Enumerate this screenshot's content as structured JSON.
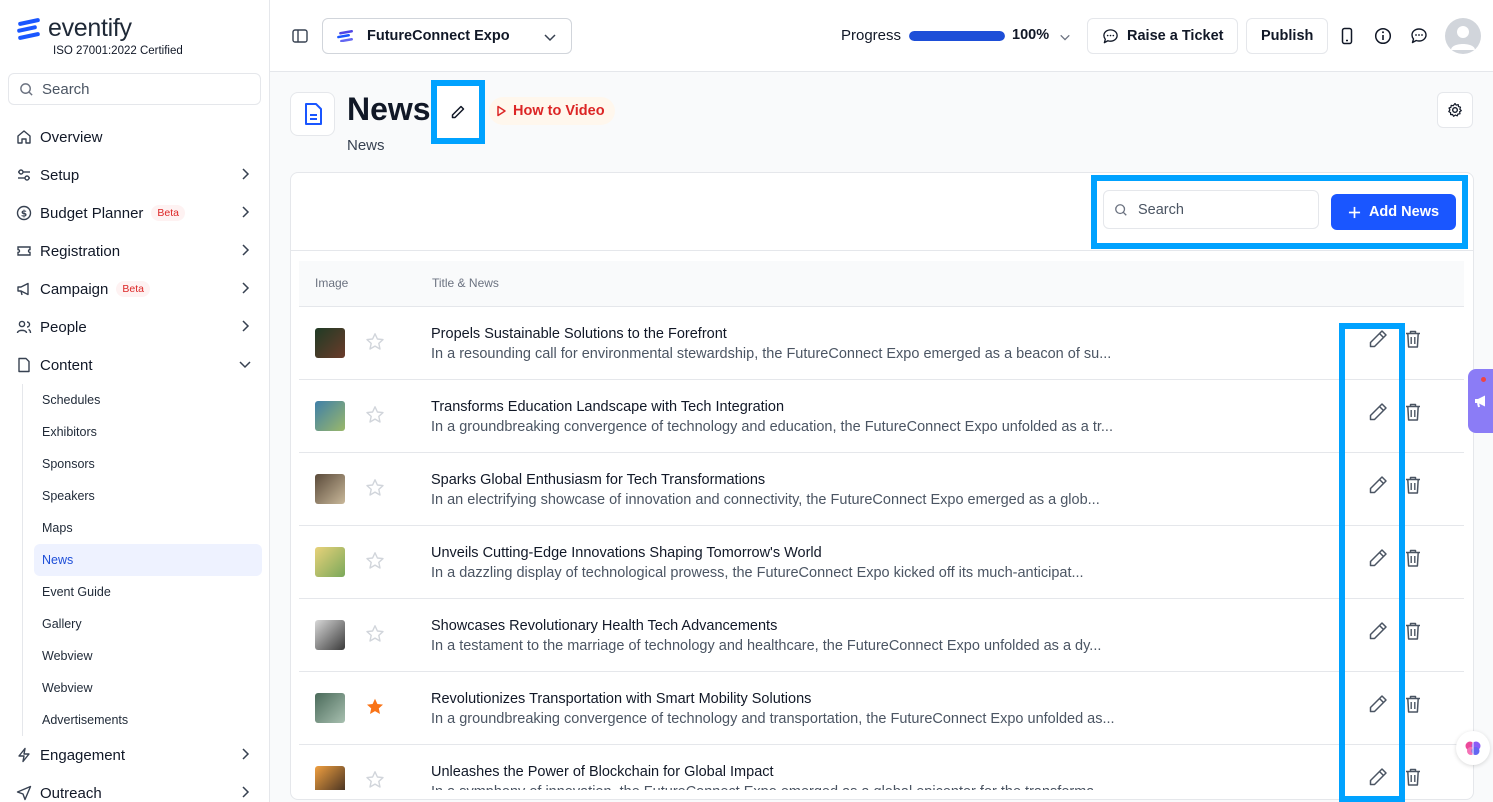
{
  "brand": {
    "name": "eventify",
    "certification": "ISO 27001:2022 Certified"
  },
  "sidebar": {
    "search_placeholder": "Search",
    "items": [
      {
        "label": "Overview",
        "icon": "home-icon"
      },
      {
        "label": "Setup",
        "icon": "sliders-icon"
      },
      {
        "label": "Budget Planner",
        "icon": "dollar-icon",
        "badge": "Beta"
      },
      {
        "label": "Registration",
        "icon": "ticket-icon"
      },
      {
        "label": "Campaign",
        "icon": "megaphone-icon",
        "badge": "Beta"
      },
      {
        "label": "People",
        "icon": "people-icon"
      },
      {
        "label": "Content",
        "icon": "document-icon"
      }
    ],
    "content_sub": [
      "Schedules",
      "Exhibitors",
      "Sponsors",
      "Speakers",
      "Maps",
      "News",
      "Event Guide",
      "Gallery",
      "Webview",
      "Webview",
      "Advertisements"
    ],
    "active_sub": "News",
    "bottom_items": [
      {
        "label": "Engagement",
        "icon": "bolt-icon"
      },
      {
        "label": "Outreach",
        "icon": "send-icon"
      }
    ]
  },
  "topbar": {
    "event_name": "FutureConnect Expo",
    "progress_label": "Progress",
    "progress_value": "100%",
    "progress_fraction": 1.0,
    "raise_ticket": "Raise a Ticket",
    "publish": "Publish"
  },
  "page": {
    "title": "News",
    "how_to": "How to Video",
    "subtitle": "News"
  },
  "news_panel": {
    "search_placeholder": "Search",
    "add_label": "Add News",
    "columns": [
      "Image",
      "Title & News"
    ],
    "rows": [
      {
        "title": "Propels Sustainable Solutions to the Forefront",
        "desc": "In a resounding call for environmental stewardship, the FutureConnect Expo emerged as a beacon of su...",
        "starred": false,
        "thumb_colors": [
          "#1f3b25",
          "#6b3b2a"
        ]
      },
      {
        "title": "Transforms Education Landscape with Tech Integration",
        "desc": "In a groundbreaking convergence of technology and education, the FutureConnect Expo unfolded as a tr...",
        "starred": false,
        "thumb_colors": [
          "#3f7fa8",
          "#9bb86a"
        ]
      },
      {
        "title": "Sparks Global Enthusiasm for Tech Transformations",
        "desc": "In an electrifying showcase of innovation and connectivity, the FutureConnect Expo emerged as a glob...",
        "starred": false,
        "thumb_colors": [
          "#5a4a3a",
          "#c9b89a"
        ]
      },
      {
        "title": "Unveils Cutting-Edge Innovations Shaping Tomorrow's World",
        "desc": "In a dazzling display of technological prowess, the FutureConnect Expo kicked off its much-anticipat...",
        "starred": false,
        "thumb_colors": [
          "#e8d27a",
          "#7aa85a"
        ]
      },
      {
        "title": "Showcases Revolutionary Health Tech Advancements",
        "desc": "In a testament to the marriage of technology and healthcare, the FutureConnect Expo unfolded as a dy...",
        "starred": false,
        "thumb_colors": [
          "#d8d8d8",
          "#3a3a3a"
        ]
      },
      {
        "title": "Revolutionizes Transportation with Smart Mobility Solutions",
        "desc": "In a groundbreaking convergence of technology and transportation, the FutureConnect Expo unfolded as...",
        "starred": true,
        "thumb_colors": [
          "#4a6a5a",
          "#a8c0b0"
        ]
      },
      {
        "title": "Unleashes the Power of Blockchain for Global Impact",
        "desc": "In a symphony of innovation, the FutureConnect Expo emerged as a global epicenter for the transforma...",
        "starred": false,
        "thumb_colors": [
          "#f0a040",
          "#3a2a20"
        ]
      }
    ]
  },
  "colors": {
    "accent": "#1a56ff",
    "highlight": "#00a2ff",
    "star_active": "#f97316",
    "beta": "#dc2626"
  }
}
